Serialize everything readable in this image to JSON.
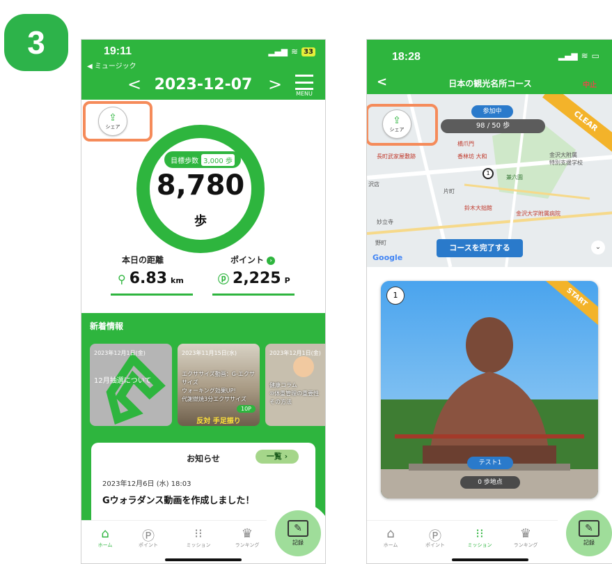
{
  "step_number": "3",
  "phoneA": {
    "status": {
      "time": "19:11",
      "back_app": "◀ ミュージック",
      "battery": "33"
    },
    "date": "2023-12-07",
    "menu_label": "MENU",
    "share_label": "シェア",
    "goal": {
      "label": "目標歩数",
      "value": "3,000 歩"
    },
    "steps": {
      "value": "8,780",
      "unit": "歩"
    },
    "distance": {
      "label": "本日の距離",
      "value": "6.83",
      "unit": "km"
    },
    "points": {
      "label": "ポイント",
      "value": "2,225",
      "unit": "P"
    },
    "news_title": "新着情報",
    "news_cards": [
      {
        "date": "2023年12月1日(金)",
        "text": "12月抽選について"
      },
      {
        "date": "2023年11月15日(水)",
        "text": "エクササイズ動画：G-エクササイズ\nウォーキング効果UP!\n代謝燃焼3分エクササイズ",
        "caption": "反対 手足振り",
        "badge": "10P"
      },
      {
        "date": "2023年12月1日(金)",
        "text": "健康コラム\n⑩体重管理の重要性\nその方法"
      }
    ],
    "notice": {
      "title": "お知らせ",
      "all_label": "一覧",
      "date": "2023年12月6日 (水) 18:03",
      "headline": "Gウォラダンス動画を作成しました！"
    },
    "tabs": [
      "ホーム",
      "ポイント",
      "ミッション",
      "ランキング"
    ],
    "active_tab": "ホーム",
    "record_label": "記録"
  },
  "phoneB": {
    "status": {
      "time": "18:28"
    },
    "title": "日本の観光名所コース",
    "quit_label": "中止",
    "share_label": "シェア",
    "joining_label": "参加中",
    "progress": "98 / 50 歩",
    "clear_label": "CLEAR",
    "complete_button": "コースを完了する",
    "map_labels": [
      "橋爪門",
      "香林坊 大和",
      "長町武家屋敷跡",
      "兼六園",
      "金沢大附属\n特別支援学校",
      "片町",
      "鈴木大拙館",
      "金沢大学附属病院",
      "妙立寺",
      "野町",
      "沢店",
      "Google"
    ],
    "spot": {
      "number": "1",
      "ribbon": "START",
      "name": "テスト1",
      "distance": "0 歩地点"
    },
    "tabs": [
      "ホーム",
      "ポイント",
      "ミッション",
      "ランキング"
    ],
    "active_tab": "ミッション",
    "record_label": "記録"
  },
  "colors": {
    "brand_green": "#2eb53e",
    "highlight_orange": "#f58b5a",
    "accent_blue": "#2a7acb",
    "ribbon_yellow": "#f3b32a"
  },
  "icons": [
    "share-icon",
    "location-pin-icon",
    "point-coin-icon",
    "home-icon",
    "point-icon",
    "footprints-icon",
    "crown-icon",
    "pencil-icon",
    "menu-icon",
    "back-arrow-icon",
    "chevron-down-icon"
  ]
}
